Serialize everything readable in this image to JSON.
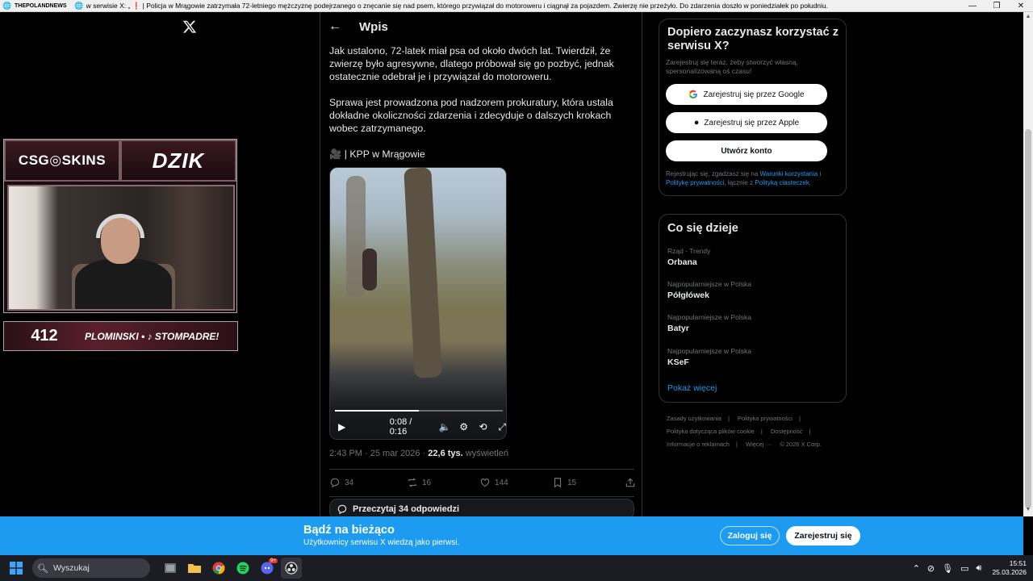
{
  "titlebar": {
    "site": "THEPOLANDNEWS",
    "text": "w serwisie X: „ ❗ | Policja w Mrągowie zatrzymała 72-letniego mężczyznę podejrzanego o znęcanie się nad psem, którego przywiązał do motoroweru i ciągnął za pojazdem. Zwierzę nie przeżyło. Do zdarzenia doszło w poniedziałek po południu."
  },
  "stream": {
    "brand_left": "CSG◎SKINS",
    "brand_right": "DZIK",
    "counter": "412",
    "ticker": "PLOMINSKI • ♪ STOMPADRE!"
  },
  "post": {
    "header_title": "Wpis",
    "paragraph1": "Jak ustalono, 72-latek miał psa od około dwóch lat. Twierdził, że zwierzę było agresywne, dlatego próbował się go pozbyć, jednak ostatecznie odebrał je i przywiązał do motoroweru.",
    "paragraph2": "Sprawa jest prowadzona pod nadzorem prokuratury, która ustala dokładne okoliczności zdarzenia i zdecyduje o dalszych krokach wobec zatrzymanego.",
    "source": "🎥 | KPP w Mrągowie",
    "video_time": "0:08 / 0:16",
    "video_progress": 0.5,
    "meta_date": "2:43 PM · 25 mar 2026 · ",
    "meta_views": "22,6 tys.",
    "meta_views_label": " wyświetleń",
    "replies": "34",
    "reposts": "16",
    "likes": "144",
    "bookmarks": "15",
    "read_replies": "Przeczytaj 34 odpowiedzi"
  },
  "signup": {
    "title": "Dopiero zaczynasz korzystać z serwisu X?",
    "subtitle": "Zarejestruj się teraz, żeby stworzyć własną, spersonalizowaną oś czasu!",
    "google_btn": "Zarejestruj się przez Google",
    "apple_btn": "Zarejestruj się przez Apple",
    "create_btn": "Utwórz konto",
    "legal_pre": "Rejestrując się, zgadzasz się na ",
    "legal_terms": "Warunki korzystania",
    "legal_sep": " i ",
    "legal_privacy": "Politykę prywatności",
    "legal_mid": ", łącznie z ",
    "legal_cookies": "Polityką ciasteczek",
    "legal_end": "."
  },
  "trends": {
    "title": "Co się dzieje",
    "items": [
      {
        "context": "Rząd · Trendy",
        "name": "Orbana"
      },
      {
        "context": "Najpopularniejsze w Polska",
        "name": "Półgłówek"
      },
      {
        "context": "Najpopularniejsze w Polska",
        "name": "Batyr"
      },
      {
        "context": "Najpopularniejsze w Polska",
        "name": "KSeF"
      }
    ],
    "show_more": "Pokaż więcej"
  },
  "footer": {
    "links": [
      "Zasady użytkowania",
      "|",
      "Polityka prywatności",
      "|",
      "Polityka dotycząca plików cookie",
      "|",
      "Dostępność",
      "|",
      "Informacje o reklamach",
      "|",
      "Więcej ···",
      "© 2026 X Corp."
    ]
  },
  "banner": {
    "title": "Bądź na bieżąco",
    "subtitle": "Użytkownicy serwisu X wiedzą jako pierwsi.",
    "login": "Zaloguj się",
    "register": "Zarejestruj się"
  },
  "taskbar": {
    "search_placeholder": "Wyszukaj",
    "discord_badge": "9+",
    "time": "15:51",
    "date": "25.03.2026"
  },
  "colors": {
    "accent": "#1d9bf0",
    "background": "#000000",
    "border": "#2f3336",
    "muted": "#71767b"
  }
}
